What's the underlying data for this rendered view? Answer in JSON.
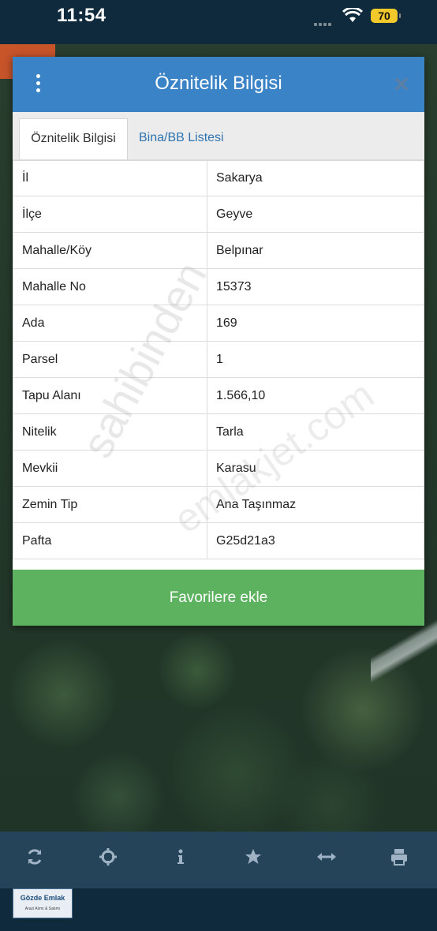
{
  "status_bar": {
    "time": "11:54",
    "battery": "70"
  },
  "modal": {
    "title": "Öznitelik Bilgisi",
    "tabs": [
      {
        "label": "Öznitelik Bilgisi",
        "active": true
      },
      {
        "label": "Bina/BB Listesi",
        "active": false
      }
    ],
    "rows": [
      {
        "key": "İl",
        "value": "Sakarya"
      },
      {
        "key": "İlçe",
        "value": "Geyve"
      },
      {
        "key": "Mahalle/Köy",
        "value": "Belpınar"
      },
      {
        "key": "Mahalle No",
        "value": "15373"
      },
      {
        "key": "Ada",
        "value": "169"
      },
      {
        "key": "Parsel",
        "value": "1"
      },
      {
        "key": "Tapu Alanı",
        "value": "1.566,10"
      },
      {
        "key": "Nitelik",
        "value": "Tarla"
      },
      {
        "key": "Mevkii",
        "value": "Karasu"
      },
      {
        "key": "Zemin Tip",
        "value": "Ana Taşınmaz"
      },
      {
        "key": "Pafta",
        "value": "G25d21a3"
      }
    ],
    "favorite_button": "Favorilere ekle"
  },
  "toolbar": {
    "icons": [
      "refresh-icon",
      "locate-icon",
      "info-icon",
      "star-icon",
      "measure-icon",
      "print-icon"
    ]
  },
  "watermark": {
    "text_1": "sahibinden",
    "text_2": "emlakjet.com"
  },
  "logo": {
    "name": "Gözde Emlak",
    "tagline": "Arazi Alımı & Satımı"
  },
  "colors": {
    "header": "#3a83c6",
    "favorite_button": "#5cb25e",
    "toolbar": "#25445a",
    "status_bar": "#0f2a3c"
  }
}
